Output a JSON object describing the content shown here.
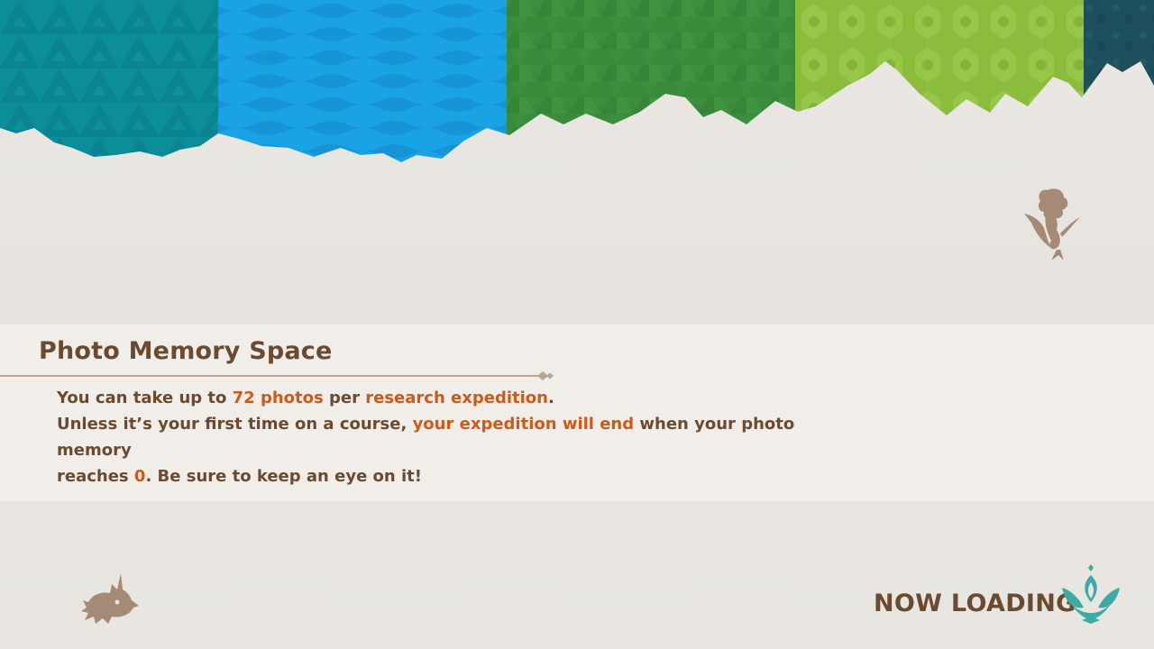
{
  "colors": {
    "teal": "#0b8d9a",
    "blue": "#1aa3e4",
    "forest": "#3d8f3f",
    "lime": "#8bbc3c",
    "dark_teal": "#1e4f5c",
    "title": "#6b4a30",
    "highlight": "#cf5a17",
    "silhouette": "#a58b76",
    "loading_icon": "#3fa9a3"
  },
  "icons": {
    "top_right": "pokemon-silhouette-icon",
    "bottom_left": "pokemon-silhouette-icon",
    "loading": "flower-emblem-icon"
  },
  "tip": {
    "title": "Photo Memory Space",
    "line1": {
      "t1": "You can take up to ",
      "h1": "72 photos",
      "t2": " per ",
      "h2": "research expedition",
      "t3": "."
    },
    "line2": {
      "t1": "Unless it’s your first time on a course, ",
      "h1": "your expedition will end",
      "t2": " when your photo memory"
    },
    "line3": {
      "t1": "reaches ",
      "h1": "0",
      "t2": ". Be sure to keep an eye on it!"
    }
  },
  "loading": {
    "label": "NOW LOADING"
  }
}
